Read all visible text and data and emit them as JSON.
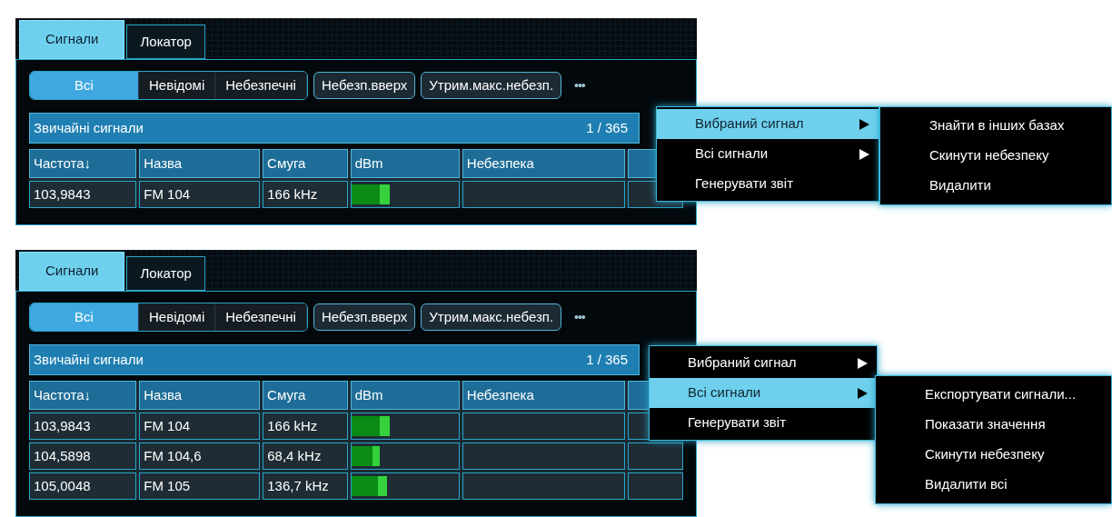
{
  "screens": [
    {
      "tabs": [
        {
          "label": "Сигнали",
          "selected": true
        },
        {
          "label": "Локатор",
          "selected": false
        }
      ],
      "segments": [
        {
          "label": "Всі",
          "selected": true
        },
        {
          "label": "Невідомі",
          "selected": false
        },
        {
          "label": "Небезпечні",
          "selected": false
        }
      ],
      "buttons": [
        "Небезп.вверх",
        "Утрим.макс.небезп."
      ],
      "more": "•••",
      "group": {
        "title": "Звичайні сигнали",
        "count": "1 / 365"
      },
      "columns": [
        "Частота↓",
        "Назва",
        "Смуга",
        "dBm",
        "Небезпека"
      ],
      "rows": [
        {
          "frequency": "103,9843",
          "name": "FM 104",
          "bandwidth": "166 kHz",
          "level": 0.36
        }
      ],
      "menu": [
        {
          "label": "Вибраний сигнал",
          "selected": true,
          "has_submenu": true
        },
        {
          "label": "Всі сигнали",
          "selected": false,
          "has_submenu": true
        },
        {
          "label": "Генерувати звіт",
          "selected": false,
          "has_submenu": false
        }
      ],
      "submenu": [
        "Знайти в інших базах",
        "Скинути небезпеку",
        "Видалити"
      ]
    },
    {
      "tabs": [
        {
          "label": "Сигнали",
          "selected": true
        },
        {
          "label": "Локатор",
          "selected": false
        }
      ],
      "segments": [
        {
          "label": "Всі",
          "selected": true
        },
        {
          "label": "Невідомі",
          "selected": false
        },
        {
          "label": "Небезпечні",
          "selected": false
        }
      ],
      "buttons": [
        "Небезп.вверх",
        "Утрим.макс.небезп."
      ],
      "more": "•••",
      "group": {
        "title": "Звичайні сигнали",
        "count": "1 / 365"
      },
      "columns": [
        "Частота↓",
        "Назва",
        "Смуга",
        "dBm",
        "Небезпека"
      ],
      "rows": [
        {
          "frequency": "103,9843",
          "name": "FM 104",
          "bandwidth": "166 kHz",
          "level": 0.36
        },
        {
          "frequency": "104,5898",
          "name": "FM 104,6",
          "bandwidth": "68,4 kHz",
          "level": 0.26
        },
        {
          "frequency": "105,0048",
          "name": "FM 105",
          "bandwidth": "136,7 kHz",
          "level": 0.33
        }
      ],
      "menu": [
        {
          "label": "Вибраний сигнал",
          "selected": false,
          "has_submenu": true
        },
        {
          "label": "Всі сигнали",
          "selected": true,
          "has_submenu": true
        },
        {
          "label": "Генерувати звіт",
          "selected": false,
          "has_submenu": false
        }
      ],
      "submenu": [
        "Експортувати сигнали...",
        "Показати значення",
        "Скинути небезпеку",
        "Видалити всі"
      ]
    }
  ]
}
